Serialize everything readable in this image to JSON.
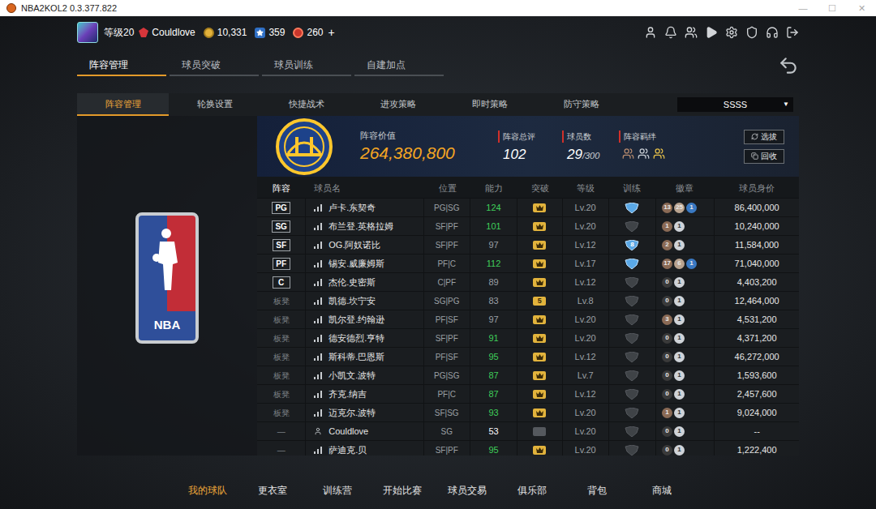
{
  "window": {
    "title": "NBA2KOL2 0.3.377.822",
    "controls": [
      "—",
      "☐",
      "✕"
    ]
  },
  "header": {
    "level": "等级20",
    "username": "Couldlove",
    "currencies": [
      {
        "kind": "coin",
        "amount": "10,331"
      },
      {
        "kind": "star",
        "amount": "359"
      },
      {
        "kind": "ticket",
        "amount": "260"
      }
    ],
    "add": "+"
  },
  "main_tabs": [
    {
      "label": "阵容管理",
      "selected": true
    },
    {
      "label": "球员突破",
      "selected": false
    },
    {
      "label": "球员训练",
      "selected": false
    },
    {
      "label": "自建加点",
      "selected": false
    }
  ],
  "sub_tabs": [
    {
      "label": "阵容管理",
      "selected": true
    },
    {
      "label": "轮换设置",
      "selected": false
    },
    {
      "label": "快捷战术",
      "selected": false
    },
    {
      "label": "进攻策略",
      "selected": false
    },
    {
      "label": "即时策略",
      "selected": false
    },
    {
      "label": "防守策略",
      "selected": false
    }
  ],
  "dropdown": {
    "value": "SSSS",
    "arrow": "▼"
  },
  "logo": {
    "text": "NBA"
  },
  "summary": {
    "value_label": "阵容价值",
    "value": "264,380,800",
    "rating": {
      "label": "阵容总评",
      "value": "102"
    },
    "count": {
      "label": "球员数",
      "value": "29",
      "suffix": "/300"
    },
    "bonds": {
      "label": "阵容羁绊"
    },
    "buttons": [
      "选拔",
      "回收"
    ]
  },
  "table": {
    "columns": [
      "阵容",
      "球员名",
      "位置",
      "能力",
      "突破",
      "等级",
      "训练",
      "徽章",
      "球员身价"
    ],
    "rows": [
      {
        "slot": "PG",
        "slot_kind": "starter",
        "kind": "player",
        "name": "卢卡.东契奇",
        "position": "PG|SG",
        "ability": "124",
        "ability_color": "#3fcf5a",
        "break_kind": "crown",
        "level": "Lv.20",
        "training_kind": "active",
        "badges": [
          {
            "text": "13",
            "color": "#8a6a55"
          },
          {
            "text": "25",
            "color": "#b9a38f"
          },
          {
            "text": "1",
            "color": "#3a79c2"
          }
        ],
        "value": "86,400,000"
      },
      {
        "slot": "SG",
        "slot_kind": "starter",
        "kind": "player",
        "name": "布兰登.英格拉姆",
        "position": "SF|PF",
        "ability": "101",
        "ability_color": "#3fcf5a",
        "break_kind": "crown",
        "level": "Lv.20",
        "training_kind": "empty",
        "badges": [
          {
            "text": "1",
            "color": "#8a6a55"
          },
          {
            "text": "1",
            "color": "#cfd3d8"
          }
        ],
        "value": "10,240,000"
      },
      {
        "slot": "SF",
        "slot_kind": "starter",
        "kind": "player",
        "name": "OG.阿奴诺比",
        "position": "SF|PF",
        "ability": "97",
        "ability_color": "#9aa0a6",
        "break_kind": "crown",
        "level": "Lv.12",
        "training_kind": "number",
        "training_text": "8",
        "badges": [
          {
            "text": "2",
            "color": "#8a6a55"
          },
          {
            "text": "1",
            "color": "#cfd3d8"
          }
        ],
        "value": "11,584,000"
      },
      {
        "slot": "PF",
        "slot_kind": "starter",
        "kind": "player",
        "name": "锡安.威廉姆斯",
        "position": "PF|C",
        "ability": "112",
        "ability_color": "#3fcf5a",
        "break_kind": "crown",
        "level": "Lv.17",
        "training_kind": "active",
        "badges": [
          {
            "text": "17",
            "color": "#8a6a55"
          },
          {
            "text": "6",
            "color": "#b9a38f"
          },
          {
            "text": "1",
            "color": "#3a79c2"
          }
        ],
        "value": "71,040,000"
      },
      {
        "slot": "C",
        "slot_kind": "starter",
        "kind": "player",
        "name": "杰伦.史密斯",
        "position": "C|PF",
        "ability": "89",
        "ability_color": "#9aa0a6",
        "break_kind": "crown",
        "level": "Lv.12",
        "training_kind": "empty",
        "badges": [
          {
            "text": "0",
            "color": "#3a3a3a"
          },
          {
            "text": "1",
            "color": "#cfd3d8"
          }
        ],
        "value": "4,403,200"
      },
      {
        "slot": "板凳",
        "slot_kind": "bench",
        "kind": "player",
        "name": "凯德.坎宁安",
        "position": "SG|PG",
        "ability": "83",
        "ability_color": "#9aa0a6",
        "break_kind": "number",
        "break_text": "5",
        "level": "Lv.8",
        "training_kind": "empty",
        "badges": [
          {
            "text": "0",
            "color": "#3a3a3a"
          },
          {
            "text": "1",
            "color": "#cfd3d8"
          }
        ],
        "value": "12,464,000"
      },
      {
        "slot": "板凳",
        "slot_kind": "bench",
        "kind": "player",
        "name": "凯尔登.约翰逊",
        "position": "PF|SF",
        "ability": "97",
        "ability_color": "#9aa0a6",
        "break_kind": "crown",
        "level": "Lv.20",
        "training_kind": "empty",
        "badges": [
          {
            "text": "3",
            "color": "#8a6a55"
          },
          {
            "text": "1",
            "color": "#cfd3d8"
          }
        ],
        "value": "4,531,200"
      },
      {
        "slot": "板凳",
        "slot_kind": "bench",
        "kind": "player",
        "name": "德安德烈.亨特",
        "position": "SF|PF",
        "ability": "91",
        "ability_color": "#3fcf5a",
        "break_kind": "crown",
        "level": "Lv.20",
        "training_kind": "empty",
        "badges": [
          {
            "text": "0",
            "color": "#3a3a3a"
          },
          {
            "text": "1",
            "color": "#cfd3d8"
          }
        ],
        "value": "4,371,200"
      },
      {
        "slot": "板凳",
        "slot_kind": "bench",
        "kind": "player",
        "name": "斯科蒂.巴恩斯",
        "position": "PF|SF",
        "ability": "95",
        "ability_color": "#3fcf5a",
        "break_kind": "crown",
        "level": "Lv.12",
        "training_kind": "empty",
        "badges": [
          {
            "text": "0",
            "color": "#3a3a3a"
          },
          {
            "text": "1",
            "color": "#cfd3d8"
          }
        ],
        "value": "46,272,000"
      },
      {
        "slot": "板凳",
        "slot_kind": "bench",
        "kind": "player",
        "name": "小凯文.波特",
        "position": "PG|SG",
        "ability": "87",
        "ability_color": "#3fcf5a",
        "break_kind": "crown",
        "level": "Lv.7",
        "training_kind": "empty",
        "badges": [
          {
            "text": "0",
            "color": "#3a3a3a"
          },
          {
            "text": "1",
            "color": "#cfd3d8"
          }
        ],
        "value": "1,593,600"
      },
      {
        "slot": "板凳",
        "slot_kind": "bench",
        "kind": "player",
        "name": "齐克.纳吉",
        "position": "PF|C",
        "ability": "87",
        "ability_color": "#3fcf5a",
        "break_kind": "crown",
        "level": "Lv.12",
        "training_kind": "empty",
        "badges": [
          {
            "text": "0",
            "color": "#3a3a3a"
          },
          {
            "text": "1",
            "color": "#cfd3d8"
          }
        ],
        "value": "2,457,600"
      },
      {
        "slot": "板凳",
        "slot_kind": "bench",
        "kind": "player",
        "name": "迈克尔.波特",
        "position": "SF|SG",
        "ability": "93",
        "ability_color": "#3fcf5a",
        "break_kind": "crown",
        "level": "Lv.20",
        "training_kind": "empty",
        "badges": [
          {
            "text": "1",
            "color": "#8a6a55"
          },
          {
            "text": "1",
            "color": "#cfd3d8"
          }
        ],
        "value": "9,024,000"
      },
      {
        "slot": "—",
        "slot_kind": "none",
        "kind": "user",
        "name": "Couldlove",
        "position": "SG",
        "ability": "53",
        "ability_color": "#ffffff",
        "break_kind": "empty",
        "level": "Lv.20",
        "training_kind": "empty",
        "badges": [
          {
            "text": "0",
            "color": "#3a3a3a"
          },
          {
            "text": "1",
            "color": "#cfd3d8"
          }
        ],
        "value": "--"
      },
      {
        "slot": "—",
        "slot_kind": "none",
        "kind": "player",
        "name": "萨迪克.贝",
        "position": "SF|PF",
        "ability": "95",
        "ability_color": "#3fcf5a",
        "break_kind": "crown",
        "level": "Lv.20",
        "training_kind": "empty",
        "badges": [
          {
            "text": "0",
            "color": "#3a3a3a"
          },
          {
            "text": "1",
            "color": "#cfd3d8"
          }
        ],
        "value": "1,222,400"
      }
    ]
  },
  "bottom_nav": [
    {
      "label": "我的球队",
      "selected": true
    },
    {
      "label": "更衣室",
      "selected": false
    },
    {
      "label": "训练营",
      "selected": false
    },
    {
      "label": "开始比赛",
      "selected": false
    },
    {
      "label": "球员交易",
      "selected": false
    },
    {
      "label": "俱乐部",
      "selected": false
    },
    {
      "label": "背包",
      "selected": false
    },
    {
      "label": "商城",
      "selected": false
    }
  ]
}
